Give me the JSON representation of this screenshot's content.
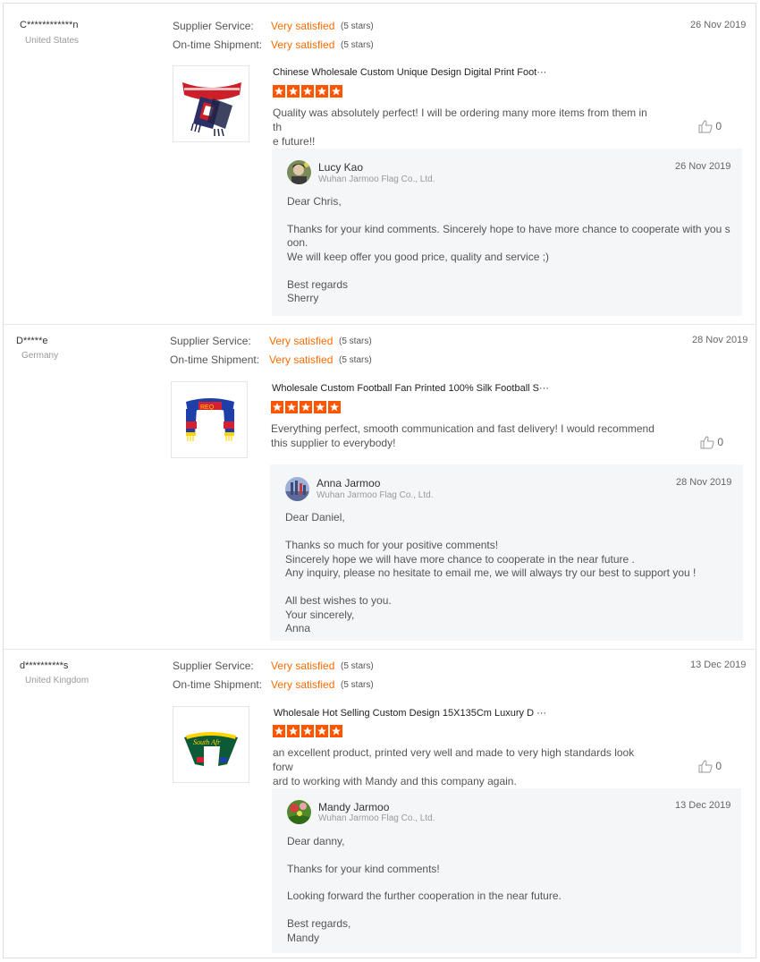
{
  "labels": {
    "supplier_service": "Supplier Service:",
    "ontime_shipment": "On-time Shipment:"
  },
  "colors": {
    "accent": "#ff6a00",
    "reply_bg": "#f5f6f8",
    "star": "#ff5500"
  },
  "reviews": [
    {
      "buyer": "C************n",
      "country": "United States",
      "supplier_service": "Very satisfied",
      "supplier_service_stars": "(5 stars)",
      "ontime_shipment": "Very satisfied",
      "ontime_shipment_stars": "(5 stars)",
      "date": "26 Nov 2019",
      "product_title": "Chinese Wholesale Custom Unique Design Digital Print Foot···",
      "rating": 5,
      "comment_lines": [
        "Quality was absolutely perfect! I will be ordering many more items from them in th",
        "e future!!"
      ],
      "likes": "0",
      "reply": {
        "name": "Lucy Kao",
        "company": "Wuhan Jarmoo Flag Co., Ltd.",
        "date": "26 Nov 2019",
        "lines": [
          "Dear Chris,",
          "",
          "Thanks for your kind comments.  Sincerely hope to have more chance to cooperate with you s",
          "oon.",
          "We will keep offer you good price, quality and service ;)",
          "",
          "Best regards",
          "Sherry"
        ]
      }
    },
    {
      "buyer": "D*****e",
      "country": "Germany",
      "supplier_service": "Very satisfied",
      "supplier_service_stars": "(5 stars)",
      "ontime_shipment": "Very satisfied",
      "ontime_shipment_stars": "(5 stars)",
      "date": "28 Nov 2019",
      "product_title": "Wholesale Custom Football Fan Printed 100% Silk Football S···",
      "rating": 5,
      "comment_lines": [
        "Everything perfect, smooth communication and fast delivery! I would recommend",
        "this supplier to everybody!"
      ],
      "likes": "0",
      "reply": {
        "name": "Anna Jarmoo",
        "company": "Wuhan Jarmoo Flag Co., Ltd.",
        "date": "28 Nov 2019",
        "lines": [
          "Dear Daniel,",
          "",
          "Thanks so much for your positive comments!",
          "Sincerely hope we will have more chance to cooperate in the near future .",
          "Any inquiry,  please no hesitate to email me,  we will always try our best to support you !",
          "",
          "All best wishes to you.",
          "Your sincerely,",
          "Anna"
        ]
      }
    },
    {
      "buyer": "d**********s",
      "country": "United Kingdom",
      "supplier_service": "Very satisfied",
      "supplier_service_stars": "(5 stars)",
      "ontime_shipment": "Very satisfied",
      "ontime_shipment_stars": "(5 stars)",
      "date": "13 Dec 2019",
      "product_title": "Wholesale Hot Selling Custom Design 15X135Cm Luxury D   ···",
      "rating": 5,
      "comment_lines": [
        "an excellent product, printed very well and made to very high standards look forw",
        "ard to working with Mandy and this company again."
      ],
      "likes": "0",
      "reply": {
        "name": "Mandy Jarmoo",
        "company": "Wuhan Jarmoo Flag Co., Ltd.",
        "date": "13 Dec 2019",
        "lines": [
          "Dear danny,",
          "",
          "Thanks for your kind comments!",
          "",
          "Looking forward the further cooperation in the near future.",
          "",
          "Best regards,",
          "Mandy"
        ]
      }
    }
  ]
}
